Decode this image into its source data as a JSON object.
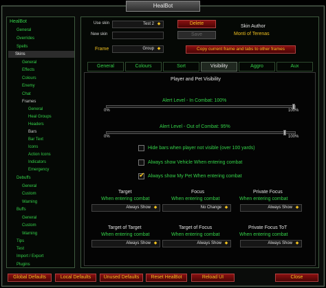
{
  "window": {
    "title": "HealBot"
  },
  "sidebar": {
    "items": [
      {
        "label": "HealBot"
      },
      {
        "label": "General"
      },
      {
        "label": "Overrides"
      },
      {
        "label": "Spells"
      },
      {
        "label": "Skins"
      },
      {
        "label": "General"
      },
      {
        "label": "Effects"
      },
      {
        "label": "Colours"
      },
      {
        "label": "Enemy"
      },
      {
        "label": "Chat"
      },
      {
        "label": "Frames"
      },
      {
        "label": "General"
      },
      {
        "label": "Heal Groups"
      },
      {
        "label": "Headers"
      },
      {
        "label": "Bars"
      },
      {
        "label": "Bar Text"
      },
      {
        "label": "Icons"
      },
      {
        "label": "Action Icons"
      },
      {
        "label": "Indicators"
      },
      {
        "label": "Emergency"
      },
      {
        "label": "Debuffs"
      },
      {
        "label": "General"
      },
      {
        "label": "Custom"
      },
      {
        "label": "Warning"
      },
      {
        "label": "Buffs"
      },
      {
        "label": "General"
      },
      {
        "label": "Custom"
      },
      {
        "label": "Warning"
      },
      {
        "label": "Tips"
      },
      {
        "label": "Test"
      },
      {
        "label": "Import / Export"
      },
      {
        "label": "Plugins"
      }
    ]
  },
  "skin": {
    "use_skin_label": "Use skin",
    "use_skin_value": "Test 2",
    "delete_label": "Delete",
    "new_skin_label": "New skin",
    "save_label": "Save",
    "frame_label": "Frame",
    "frame_value": "Group",
    "copy_label": "Copy current frame and tabs to other frames",
    "author_title": "Skin Author",
    "author_name": "Monti of Terenas"
  },
  "tabs": [
    {
      "label": "General"
    },
    {
      "label": "Colours"
    },
    {
      "label": "Sort"
    },
    {
      "label": "Visibility"
    },
    {
      "label": "Aggro"
    },
    {
      "label": "Aux"
    }
  ],
  "visibility": {
    "section_title": "Player and Pet Visibility",
    "alert_in_combat": {
      "label": "Alert Level - In Combat: 100%",
      "min": "0%",
      "max": "100%",
      "value": 1.0
    },
    "alert_out_combat": {
      "label": "Alert Level - Out of Combat: 95%",
      "min": "0%",
      "max": "100%",
      "value": 0.95
    },
    "checks": [
      {
        "label": "Hide bars when player not visible (over 100 yards)",
        "checked": false
      },
      {
        "label": "Always show Vehicle When entering combat",
        "checked": false
      },
      {
        "label": "Always show My Pet When entering combat",
        "checked": true
      }
    ],
    "targets": [
      {
        "title": "Target",
        "sub": "When entering combat",
        "value": "Always Show"
      },
      {
        "title": "Focus",
        "sub": "When entering combat",
        "value": "No Change"
      },
      {
        "title": "Private Focus",
        "sub": "When entering combat",
        "value": "Always Show"
      },
      {
        "title": "Target of Target",
        "sub": "When entering combat",
        "value": "Always Show"
      },
      {
        "title": "Target of Focus",
        "sub": "When entering combat",
        "value": "Always Show"
      },
      {
        "title": "Private Focus ToT",
        "sub": "When entering combat",
        "value": "Always Show"
      }
    ]
  },
  "footer": {
    "buttons": [
      {
        "label": "Global Defaults"
      },
      {
        "label": "Local Defaults"
      },
      {
        "label": "Unused Defaults"
      },
      {
        "label": "Reset HealBot"
      },
      {
        "label": "Reload UI"
      },
      {
        "label": "Close"
      }
    ]
  },
  "colors": {
    "accent_green": "#35d44a",
    "accent_gold": "#f0c020",
    "button_red": "#8a1010"
  }
}
